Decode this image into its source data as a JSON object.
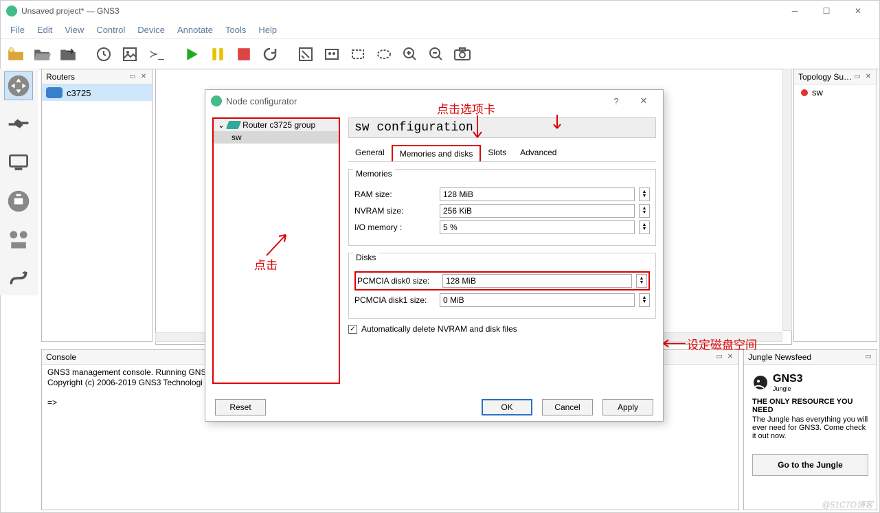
{
  "title": "Unsaved project* — GNS3",
  "menu": [
    "File",
    "Edit",
    "View",
    "Control",
    "Device",
    "Annotate",
    "Tools",
    "Help"
  ],
  "routers_panel": {
    "title": "Routers",
    "item": "c3725"
  },
  "topology": {
    "title": "Topology Su…",
    "item": "sw"
  },
  "console": {
    "title": "Console",
    "line1": "GNS3 management console. Running GNS3 v",
    "line2": "Copyright (c) 2006-2019 GNS3 Technologi",
    "prompt": "=>"
  },
  "news": {
    "title": "Jungle Newsfeed",
    "brand": "GNS3",
    "brand2": "Jungle",
    "head": "THE ONLY RESOURCE YOU NEED",
    "body": "The Jungle has everything you will ever need for GNS3. Come check it out now.",
    "button": "Go to the Jungle"
  },
  "dialog": {
    "title": "Node configurator",
    "tree_parent": "Router c3725 group",
    "tree_child": "sw",
    "config_title": "sw configuration",
    "tabs": {
      "general": "General",
      "mem": "Memories and disks",
      "slots": "Slots",
      "adv": "Advanced"
    },
    "mem_group": "Memories",
    "ram_label": "RAM size:",
    "ram_val": "128 MiB",
    "nvram_label": "NVRAM size:",
    "nvram_val": "256 KiB",
    "io_label": "I/O memory :",
    "io_val": "5 %",
    "disk_group": "Disks",
    "d0_label": "PCMCIA disk0 size:",
    "d0_val": "128 MiB",
    "d1_label": "PCMCIA disk1 size:",
    "d1_val": "0 MiB",
    "chk": "Automatically delete NVRAM and disk files",
    "btn_reset": "Reset",
    "btn_ok": "OK",
    "btn_cancel": "Cancel",
    "btn_apply": "Apply"
  },
  "annotations": {
    "tab_hint": "点击选项卡",
    "tree_hint": "点击",
    "disk_hint": "设定磁盘空间"
  },
  "watermark": "@51CTO博客"
}
